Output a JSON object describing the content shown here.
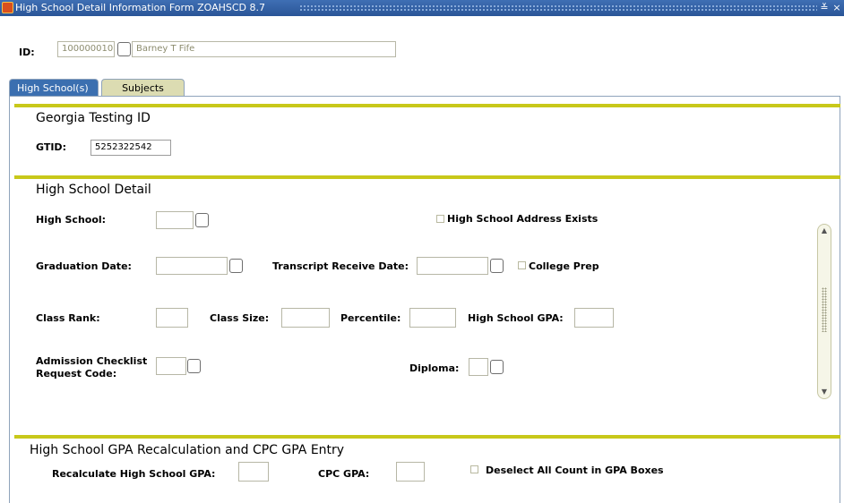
{
  "window": {
    "title": "High School Detail Information Form  ZOAHSCD  8.7",
    "minimize_glyph": "≚",
    "close_glyph": "×"
  },
  "key_block": {
    "id_label": "ID:",
    "id_value": "100000010",
    "name_value": "Barney T Fife"
  },
  "tabs": [
    {
      "label": "High School(s)",
      "active": true
    },
    {
      "label": "Subjects",
      "active": false
    }
  ],
  "testing_section": {
    "title": "Georgia Testing ID",
    "gtid_label": "GTID:",
    "gtid_value": "5252322542"
  },
  "detail_section": {
    "title": "High School Detail",
    "high_school_label": "High School:",
    "address_exists_label": "High School Address Exists",
    "graduation_date_label": "Graduation Date:",
    "transcript_receive_date_label": "Transcript Receive Date:",
    "college_prep_label": "College Prep",
    "class_rank_label": "Class Rank:",
    "class_size_label": "Class Size:",
    "percentile_label": "Percentile:",
    "gpa_label": "High School GPA:",
    "admission_checklist_label_line1": "Admission Checklist",
    "admission_checklist_label_line2": "Request Code:",
    "diploma_label": "Diploma:"
  },
  "gpa_section": {
    "title": "High School GPA Recalculation and CPC GPA Entry",
    "recalc_label": "Recalculate High School GPA:",
    "cpc_gpa_label": "CPC GPA:",
    "deselect_label": "Deselect All Count in GPA Boxes"
  },
  "scrollbar": {
    "up_glyph": "▲",
    "down_glyph": "▼"
  },
  "colors": {
    "title_bar": "#2a5597",
    "active_tab": "#3b6fb0",
    "inactive_tab": "#dcdcb2",
    "section_divider": "#c8c81a"
  }
}
